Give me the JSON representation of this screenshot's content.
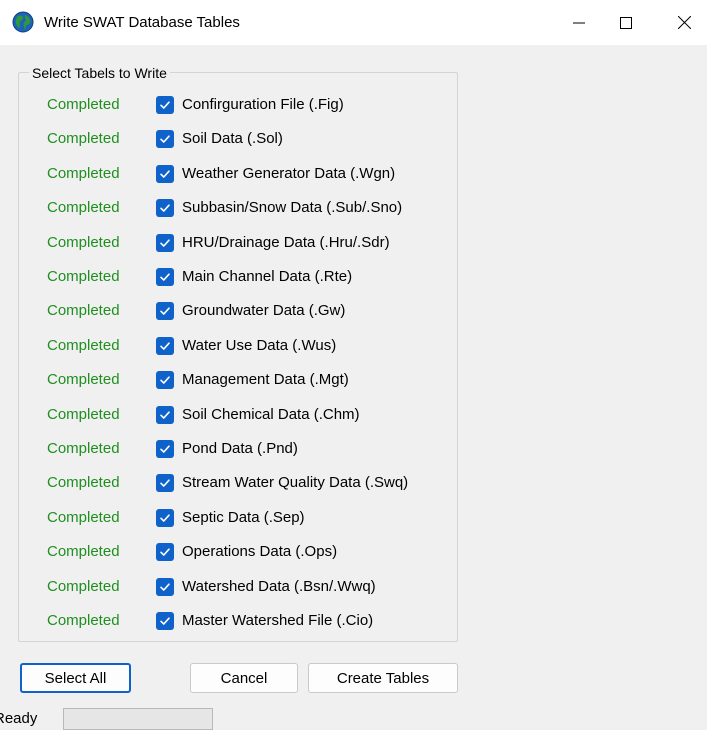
{
  "window": {
    "title": "Write SWAT Database Tables",
    "icon": "globe-icon",
    "controls": [
      "minimize-icon",
      "maximize-icon",
      "close-icon"
    ]
  },
  "group": {
    "legend": "Select Tabels to Write",
    "rows": [
      {
        "status": "Completed",
        "label": "Confirguration File (.Fig)",
        "checked": true
      },
      {
        "status": "Completed",
        "label": "Soil Data (.Sol)",
        "checked": true
      },
      {
        "status": "Completed",
        "label": "Weather Generator Data (.Wgn)",
        "checked": true
      },
      {
        "status": "Completed",
        "label": "Subbasin/Snow Data (.Sub/.Sno)",
        "checked": true
      },
      {
        "status": "Completed",
        "label": "HRU/Drainage Data (.Hru/.Sdr)",
        "checked": true
      },
      {
        "status": "Completed",
        "label": "Main Channel Data (.Rte)",
        "checked": true
      },
      {
        "status": "Completed",
        "label": "Groundwater Data (.Gw)",
        "checked": true
      },
      {
        "status": "Completed",
        "label": "Water Use Data (.Wus)",
        "checked": true
      },
      {
        "status": "Completed",
        "label": "Management Data (.Mgt)",
        "checked": true
      },
      {
        "status": "Completed",
        "label": "Soil Chemical Data (.Chm)",
        "checked": true
      },
      {
        "status": "Completed",
        "label": "Pond Data (.Pnd)",
        "checked": true
      },
      {
        "status": "Completed",
        "label": "Stream Water Quality Data (.Swq)",
        "checked": true
      },
      {
        "status": "Completed",
        "label": "Septic Data (.Sep)",
        "checked": true
      },
      {
        "status": "Completed",
        "label": "Operations Data (.Ops)",
        "checked": true
      },
      {
        "status": "Completed",
        "label": "Watershed Data (.Bsn/.Wwq)",
        "checked": true
      },
      {
        "status": "Completed",
        "label": "Master Watershed File (.Cio)",
        "checked": true
      }
    ]
  },
  "buttons": {
    "select_all": "Select All",
    "cancel": "Cancel",
    "create_tables": "Create Tables"
  },
  "statusbar": {
    "label": "Ready",
    "value": ""
  },
  "colors": {
    "status_green": "#1f8f1f",
    "checkbox_blue": "#0f62c9",
    "focus_border": "#0f62c9"
  }
}
